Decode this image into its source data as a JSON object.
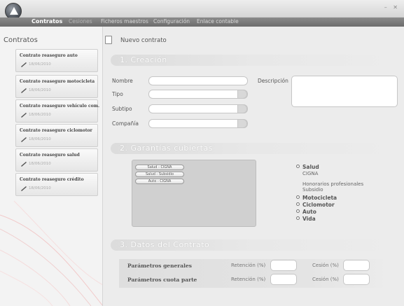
{
  "window": {
    "controls": "– ✕"
  },
  "menu": [
    {
      "label": "Contratos",
      "active": true
    },
    {
      "label": "Cesiones",
      "active": false
    },
    {
      "label": "Ficheros maestros",
      "active": false
    },
    {
      "label": "Configuración",
      "active": false
    },
    {
      "label": "Enlace contable",
      "active": false
    }
  ],
  "sidebar": {
    "title": "Contratos",
    "items": [
      {
        "title": "Contrato reaseguro auto",
        "date": "18/06/2010"
      },
      {
        "title": "Contrato reaseguro motocicleta",
        "date": "18/06/2010"
      },
      {
        "title": "Contrato reaseguro vehículo com.",
        "date": "18/06/2010"
      },
      {
        "title": "Contrato reaseguro ciclomotor",
        "date": "18/06/2010"
      },
      {
        "title": "Contrato reaseguro salud",
        "date": "18/06/2010"
      },
      {
        "title": "Contrato reaseguro crédito",
        "date": "18/06/2010"
      }
    ]
  },
  "main": {
    "header": "Nuevo contrato",
    "section1": {
      "title": "1. Creación",
      "labels": {
        "nombre": "Nombre",
        "tipo": "Tipo",
        "subtipo": "Subtipo",
        "compania": "Compañía",
        "descripcion": "Descripción"
      }
    },
    "section2": {
      "title": "2. Garantías cubiertas",
      "chips": [
        "Salud - CIGNA",
        "Salud - Subsidio",
        "Auto - CIGNA"
      ],
      "tree": {
        "salud": "Salud",
        "salud_children": [
          "CIGNA",
          "Honorarios profesionales",
          "Subsidio"
        ],
        "others": [
          "Motocicleta",
          "Ciclomotor",
          "Auto",
          "Vida"
        ]
      }
    },
    "section3": {
      "title": "3. Datos del Contrato",
      "rows": [
        {
          "label": "Parámetros generales",
          "retention": "Retención (%)",
          "cession": "Cesión (%)"
        },
        {
          "label": "Parámetros cuota parte",
          "retention": "Retención (%)",
          "cession": "Cesión (%)"
        }
      ]
    }
  },
  "colors": {
    "menubar": "#7a7a7a",
    "background": "#ececec",
    "sidebar": "#f3f3f3"
  },
  "icons": [
    "app-logo-icon",
    "pencil-icon",
    "document-icon",
    "radio-bullet-icon"
  ]
}
